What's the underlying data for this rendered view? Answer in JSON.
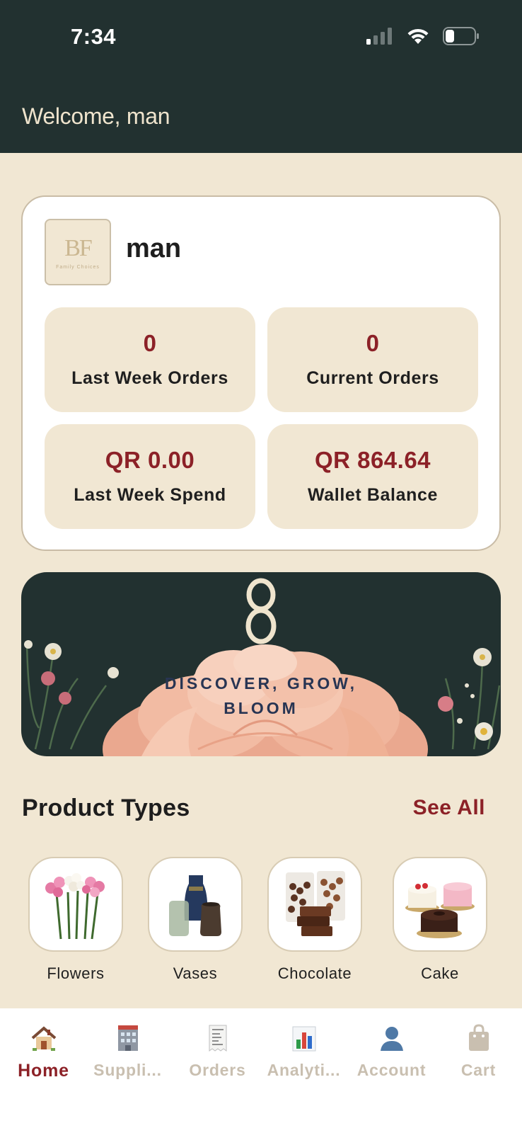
{
  "status_bar": {
    "time": "7:34",
    "icons": [
      "signal-icon",
      "wifi-icon",
      "battery-icon"
    ]
  },
  "header": {
    "welcome": "Welcome, man"
  },
  "profile": {
    "name": "man",
    "logo_monogram": "BF",
    "logo_tagline": "Family Choices"
  },
  "stats": [
    {
      "value": "0",
      "label": "Last Week Orders"
    },
    {
      "value": "0",
      "label": "Current Orders"
    },
    {
      "value": "QR 0.00",
      "label": "Last Week Spend"
    },
    {
      "value": "QR 864.64",
      "label": "Wallet Balance"
    }
  ],
  "banner": {
    "line1": "DISCOVER, GROW,",
    "line2": "BLOOM"
  },
  "product_types": {
    "title": "Product Types",
    "see_all": "See All",
    "items": [
      {
        "name": "Flowers",
        "icon": "flowers-image"
      },
      {
        "name": "Vases",
        "icon": "vases-image"
      },
      {
        "name": "Chocolate",
        "icon": "chocolate-image"
      },
      {
        "name": "Cake",
        "icon": "cake-image"
      }
    ]
  },
  "bottom_nav": {
    "items": [
      {
        "label": "Home",
        "icon": "house-icon",
        "active": true
      },
      {
        "label": "Suppli...",
        "icon": "office-building-icon"
      },
      {
        "label": "Orders",
        "icon": "receipt-icon"
      },
      {
        "label": "Analyti...",
        "icon": "bar-chart-icon"
      },
      {
        "label": "Account",
        "icon": "user-icon"
      },
      {
        "label": "Cart",
        "icon": "shopping-bag-icon"
      }
    ]
  },
  "colors": {
    "header_bg": "#223130",
    "page_bg": "#f1e7d3",
    "accent": "#8c2127"
  }
}
